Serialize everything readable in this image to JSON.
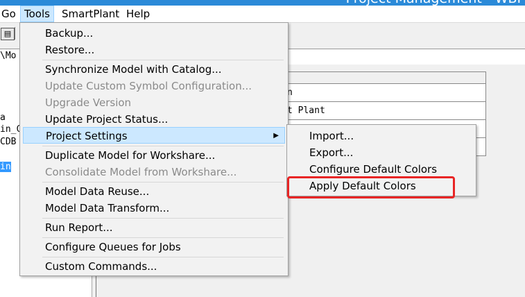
{
  "window": {
    "title": "Project Management - WBP"
  },
  "menubar": {
    "items": [
      {
        "label": "Go"
      },
      {
        "label": "Tools"
      },
      {
        "label": "SmartPlant"
      },
      {
        "label": "Help"
      }
    ]
  },
  "path": {
    "value": "\\Mo"
  },
  "tree": {
    "lines": [
      "a",
      "in_C",
      "CDB",
      "in"
    ]
  },
  "grid": {
    "rows": [
      "n",
      "t Plant",
      "",
      ""
    ]
  },
  "tools_menu": {
    "items": [
      {
        "label": "Backup...",
        "disabled": false
      },
      {
        "label": "Restore...",
        "disabled": false
      },
      {
        "label": "Synchronize Model with Catalog...",
        "disabled": false
      },
      {
        "label": "Update Custom Symbol Configuration...",
        "disabled": true
      },
      {
        "label": "Upgrade Version",
        "disabled": true
      },
      {
        "label": "Update Project Status...",
        "disabled": false
      },
      {
        "label": "Project Settings",
        "disabled": false,
        "submenu": true
      },
      {
        "label": "Duplicate Model for Workshare...",
        "disabled": false
      },
      {
        "label": "Consolidate Model from Workshare...",
        "disabled": true
      },
      {
        "label": "Model Data Reuse...",
        "disabled": false
      },
      {
        "label": "Model Data Transform...",
        "disabled": false
      },
      {
        "label": "Run Report...",
        "disabled": false
      },
      {
        "label": "Configure Queues for Jobs",
        "disabled": false
      },
      {
        "label": "Custom Commands...",
        "disabled": false
      }
    ]
  },
  "project_settings_submenu": {
    "items": [
      {
        "label": "Import..."
      },
      {
        "label": "Export..."
      },
      {
        "label": "Configure Default Colors"
      },
      {
        "label": "Apply Default Colors"
      }
    ]
  },
  "colors": {
    "highlight_box": "#e82525",
    "hover": "#cce8ff",
    "selection": "#3399ff"
  }
}
